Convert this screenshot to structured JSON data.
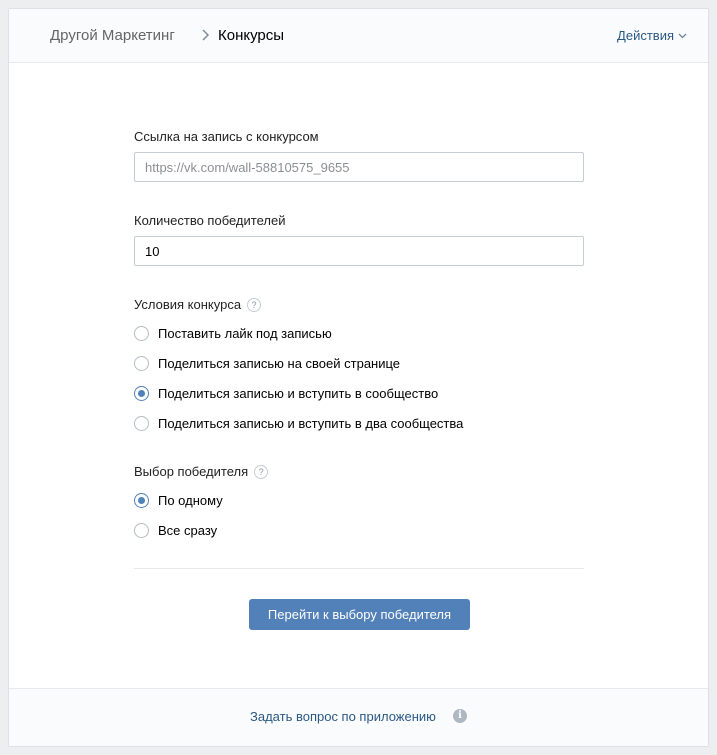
{
  "header": {
    "breadcrumb_root": "Другой Маркетинг",
    "breadcrumb_current": "Конкурсы",
    "actions_label": "Действия"
  },
  "form": {
    "post_link": {
      "label": "Ссылка на запись с конкурсом",
      "placeholder": "https://vk.com/wall-58810575_9655",
      "value": ""
    },
    "winners_count": {
      "label": "Количество победителей",
      "value": "10"
    },
    "conditions": {
      "label": "Условия конкурса",
      "help": "?",
      "options": [
        {
          "label": "Поставить лайк под записью",
          "checked": false
        },
        {
          "label": "Поделиться записью на своей странице",
          "checked": false
        },
        {
          "label": "Поделиться записью и вступить в сообщество",
          "checked": true
        },
        {
          "label": "Поделиться записью и вступить в два сообщества",
          "checked": false
        }
      ]
    },
    "winner_selection": {
      "label": "Выбор победителя",
      "help": "?",
      "options": [
        {
          "label": "По одному",
          "checked": true
        },
        {
          "label": "Все сразу",
          "checked": false
        }
      ]
    },
    "submit_label": "Перейти к выбору победителя"
  },
  "footer": {
    "ask_label": "Задать вопрос по приложению",
    "info_icon_glyph": "i"
  },
  "colors": {
    "accent": "#5181b8",
    "link": "#2a5885",
    "page_bg": "#edeef0"
  }
}
